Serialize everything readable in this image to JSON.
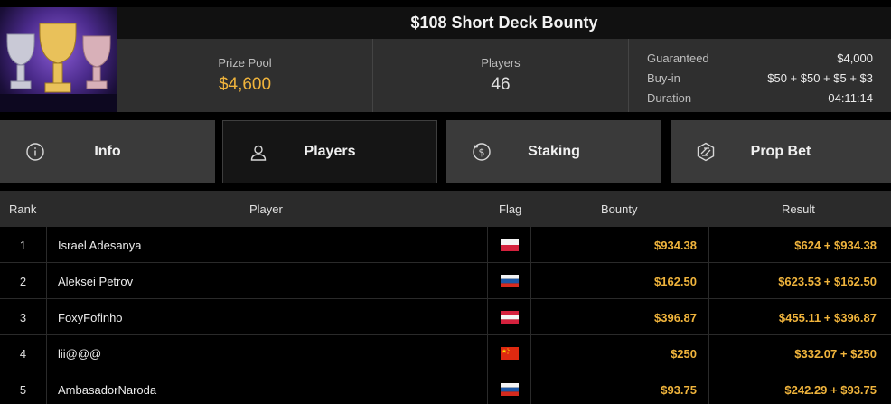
{
  "tournament": {
    "title": "$108 Short Deck Bounty"
  },
  "stats": {
    "prize_pool_label": "Prize Pool",
    "prize_pool_value": "$4,600",
    "players_label": "Players",
    "players_value": "46",
    "details": [
      {
        "label": "Guaranteed",
        "value": "$4,000"
      },
      {
        "label": "Buy-in",
        "value": "$50 + $50 + $5 + $3"
      },
      {
        "label": "Duration",
        "value": "04:11:14"
      }
    ]
  },
  "tabs": [
    {
      "label": "Info",
      "icon": "info-icon",
      "active": false
    },
    {
      "label": "Players",
      "icon": "user-icon",
      "active": true
    },
    {
      "label": "Staking",
      "icon": "dollar-coin-icon",
      "active": false
    },
    {
      "label": "Prop Bet",
      "icon": "lightning-hexagon-icon",
      "active": false
    }
  ],
  "table": {
    "headers": {
      "rank": "Rank",
      "player": "Player",
      "flag": "Flag",
      "bounty": "Bounty",
      "result": "Result"
    },
    "rows": [
      {
        "rank": "1",
        "player": "Israel Adesanya",
        "flag": "poland-flag",
        "bounty": "$934.38",
        "result": "$624 + $934.38"
      },
      {
        "rank": "2",
        "player": "Aleksei Petrov",
        "flag": "russia-flag",
        "bounty": "$162.50",
        "result": "$623.53 + $162.50"
      },
      {
        "rank": "3",
        "player": "FoxyFofinho",
        "flag": "austria-flag",
        "bounty": "$396.87",
        "result": "$455.11 + $396.87"
      },
      {
        "rank": "4",
        "player": "lii@@@",
        "flag": "china-flag",
        "bounty": "$250",
        "result": "$332.07 + $250"
      },
      {
        "rank": "5",
        "player": "AmbasadorNaroda",
        "flag": "russia-flag",
        "bounty": "$93.75",
        "result": "$242.29 + $93.75"
      }
    ]
  },
  "colors": {
    "accent_gold": "#f0b43c",
    "tab_bg": "#3a3a3a",
    "tab_active_bg": "#151515"
  }
}
